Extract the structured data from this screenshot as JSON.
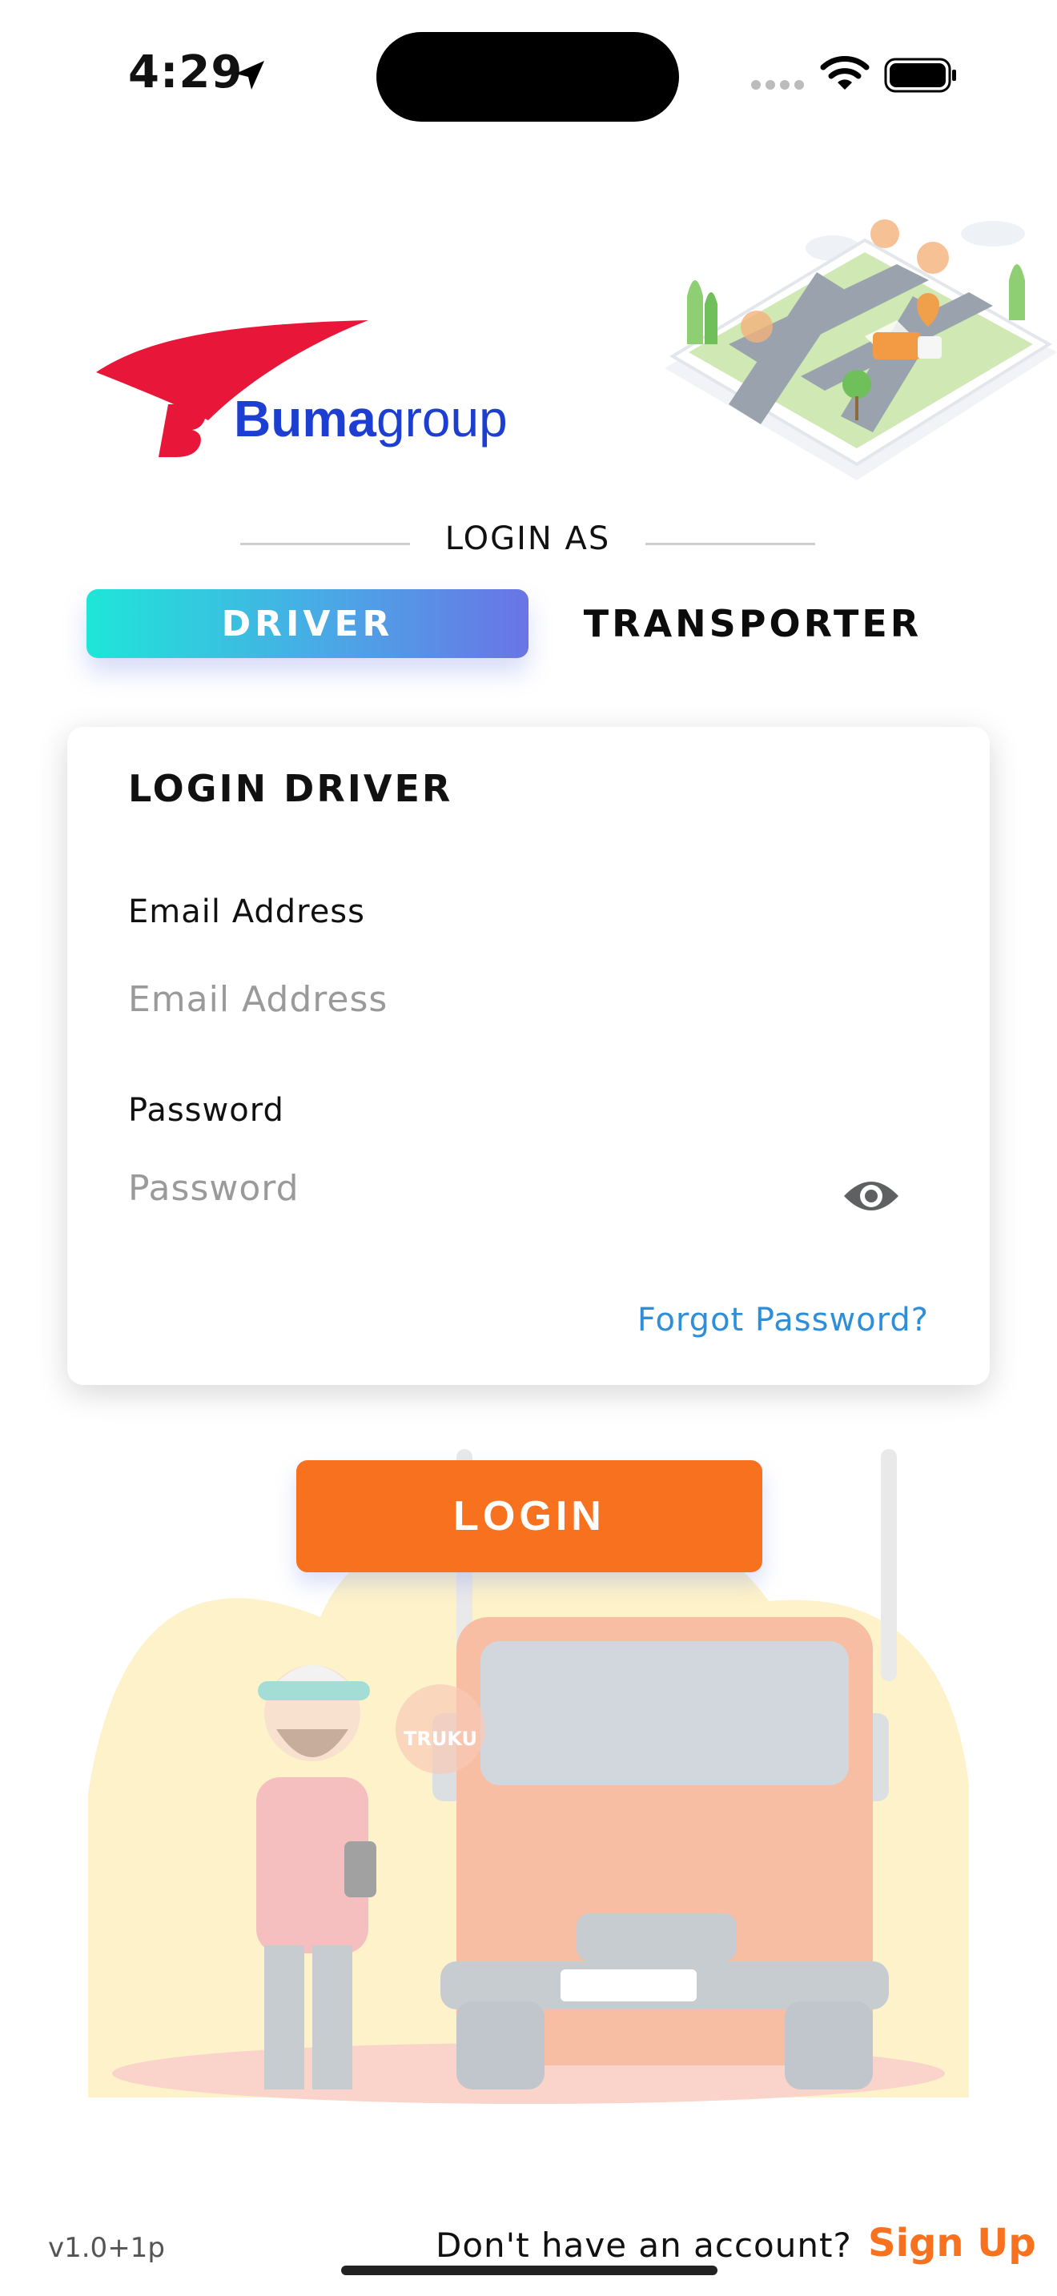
{
  "status_bar": {
    "time": "4:29"
  },
  "header": {
    "logo_text_bold": "Buma",
    "logo_text_light": "group"
  },
  "login_as": {
    "label": "LOGIN AS",
    "tabs": [
      {
        "label": "DRIVER",
        "selected": true
      },
      {
        "label": "TRANSPORTER",
        "selected": false
      }
    ]
  },
  "form": {
    "title": "LOGIN DRIVER",
    "email": {
      "label": "Email Address",
      "placeholder": "Email Address",
      "value": ""
    },
    "password": {
      "label": "Password",
      "placeholder": "Password",
      "value": ""
    },
    "forgot_label": "Forgot Password?"
  },
  "login_button": "LOGIN",
  "illustration": {
    "badge_text": "TRUKU"
  },
  "footer": {
    "version": "v1.0+1p",
    "prompt": "Don't have an account?",
    "signup_label": "Sign Up"
  },
  "colors": {
    "accent": "#f8711f",
    "link": "#2e8fd8",
    "gradient_start": "#1ee6d8",
    "gradient_end": "#6a74e6",
    "brand_red": "#e8173a",
    "brand_blue": "#1c3fd1"
  },
  "icons": {
    "status_location": "location-arrow-icon",
    "wifi": "wifi-icon",
    "battery": "battery-icon",
    "password_toggle": "eye-icon"
  }
}
